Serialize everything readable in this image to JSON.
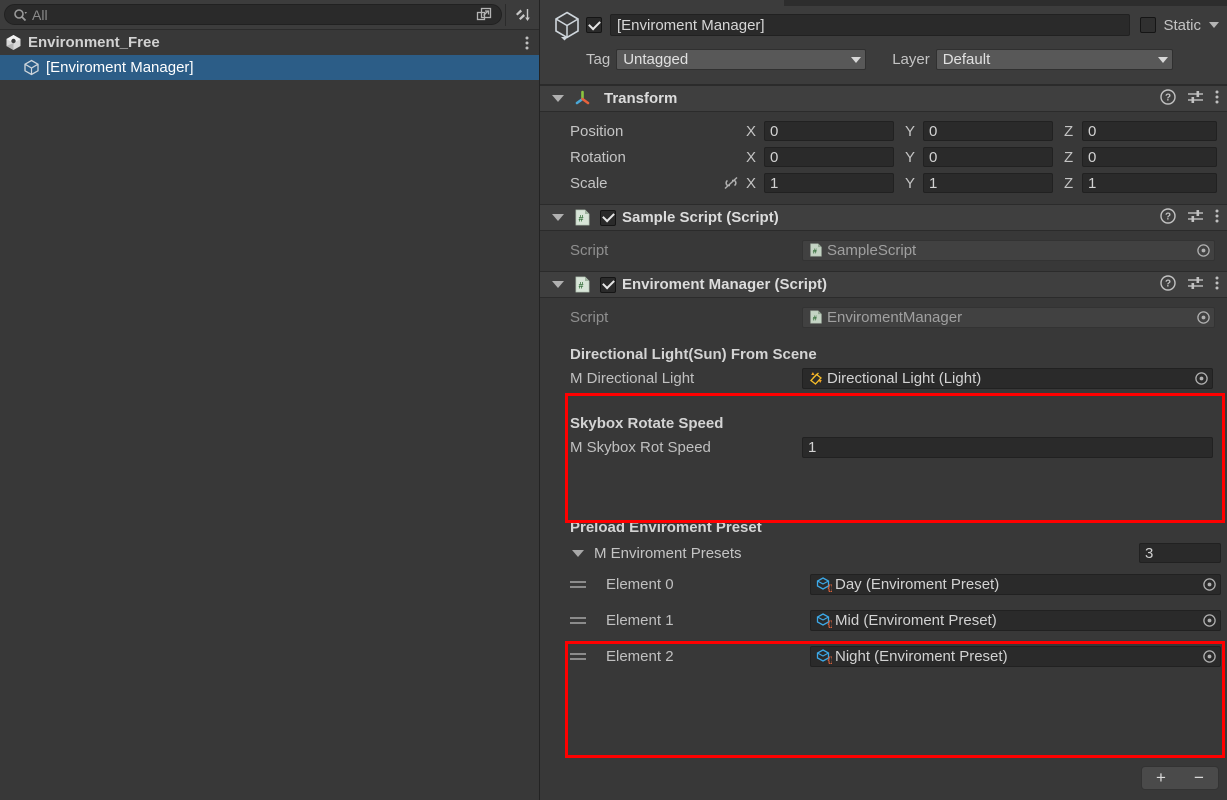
{
  "hierarchy": {
    "search": {
      "value": "All",
      "placeholder": "All",
      "icon": "search-icon"
    },
    "toolbar": {
      "expand_icon": "open-in-new-window-icon",
      "sort_icon": "sort-icon"
    },
    "scene": {
      "label": "Environment_Free",
      "icon": "unity-scene-icon",
      "kebab": "kebab-menu-icon"
    },
    "items": [
      {
        "label": "[Enviroment Manager]",
        "icon": "gameobject-cube-icon",
        "selected": true
      }
    ],
    "selection_color": "#2c5d87"
  },
  "inspector": {
    "gameobject": {
      "icon": "gameobject-cube-icon",
      "enabled": true,
      "name": "[Enviroment Manager]",
      "static_label": "Static",
      "static_checked": false,
      "tag_label": "Tag",
      "tag_value": "Untagged",
      "layer_label": "Layer",
      "layer_value": "Default"
    },
    "components": [
      {
        "title": "Transform",
        "icon": "transform-gizmo-icon",
        "has_checkbox": false,
        "actions": [
          "help-icon",
          "preset-icon",
          "kebab-menu-icon"
        ],
        "rows": [
          {
            "label": "Position",
            "x": "0",
            "y": "0",
            "z": "0"
          },
          {
            "label": "Rotation",
            "x": "0",
            "y": "0",
            "z": "0"
          },
          {
            "label": "Scale",
            "x": "1",
            "y": "1",
            "z": "1",
            "lock_icon": "constrain-proportions-off-icon"
          }
        ],
        "axis_labels": {
          "x": "X",
          "y": "Y",
          "z": "Z"
        }
      },
      {
        "title": "Sample Script (Script)",
        "icon": "cs-script-icon",
        "has_checkbox": true,
        "enabled": true,
        "actions": [
          "help-icon",
          "preset-icon",
          "kebab-menu-icon"
        ],
        "script_label": "Script",
        "script_value": "SampleScript",
        "script_icon": "cs-script-icon"
      },
      {
        "title": "Enviroment Manager (Script)",
        "icon": "cs-script-icon",
        "has_checkbox": true,
        "enabled": true,
        "actions": [
          "help-icon",
          "preset-icon",
          "kebab-menu-icon"
        ],
        "script_label": "Script",
        "script_value": "EnviromentManager",
        "script_icon": "cs-script-icon"
      }
    ],
    "env_manager": {
      "section_light": {
        "header": "Directional Light(Sun) From Scene",
        "field_label": "M Directional Light",
        "field_value": "Directional Light (Light)",
        "field_icon": "light-icon",
        "picker_icon": "object-picker-icon"
      },
      "section_skybox": {
        "header": "Skybox Rotate Speed",
        "field_label": "M Skybox Rot Speed",
        "field_value": "1"
      },
      "section_presets": {
        "header": "Preload Enviroment Preset",
        "array_label": "M Enviroment Presets",
        "array_size": "3",
        "elements": [
          {
            "label": "Element 0",
            "value": "Day (Enviroment Preset)",
            "icon": "scriptable-object-icon",
            "picker_icon": "object-picker-icon",
            "handle": "drag-handle-icon"
          },
          {
            "label": "Element 1",
            "value": "Mid (Enviroment Preset)",
            "icon": "scriptable-object-icon",
            "picker_icon": "object-picker-icon",
            "handle": "drag-handle-icon"
          },
          {
            "label": "Element 2",
            "value": "Night (Enviroment Preset)",
            "icon": "scriptable-object-icon",
            "picker_icon": "object-picker-icon",
            "handle": "drag-handle-icon"
          }
        ],
        "add_label": "+",
        "remove_label": "−"
      }
    },
    "highlight_color": "#ff0000"
  }
}
